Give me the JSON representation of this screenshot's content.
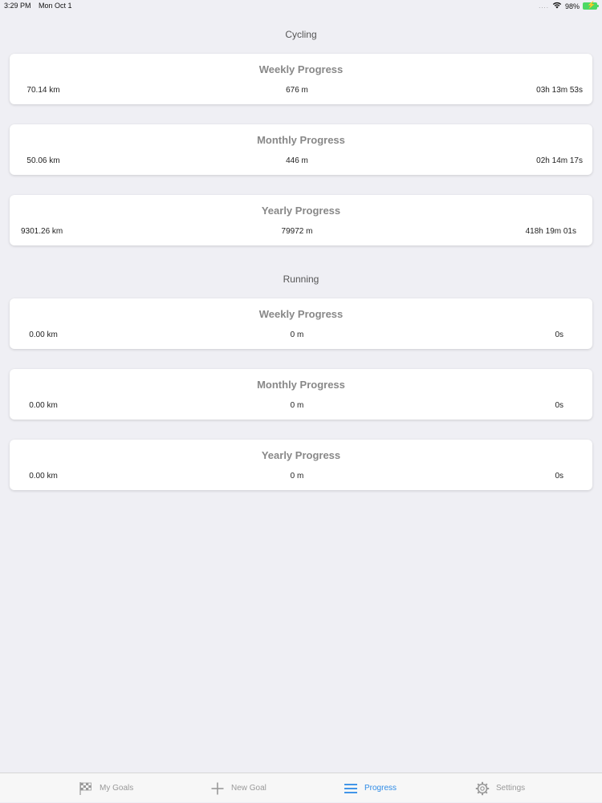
{
  "status_bar": {
    "time": "3:29 PM",
    "date": "Mon Oct 1",
    "signal": "....",
    "battery": "98%"
  },
  "sections": {
    "cycling": {
      "title": "Cycling",
      "weekly": {
        "title": "Weekly Progress",
        "distance": "70.14 km",
        "elevation": "676 m",
        "time": "03h 13m 53s"
      },
      "monthly": {
        "title": "Monthly Progress",
        "distance": "50.06 km",
        "elevation": "446 m",
        "time": "02h 14m 17s"
      },
      "yearly": {
        "title": "Yearly Progress",
        "distance": "9301.26 km",
        "elevation": "79972 m",
        "time": "418h 19m 01s"
      }
    },
    "running": {
      "title": "Running",
      "weekly": {
        "title": "Weekly Progress",
        "distance": "0.00 km",
        "elevation": "0 m",
        "time": "0s"
      },
      "monthly": {
        "title": "Monthly Progress",
        "distance": "0.00 km",
        "elevation": "0 m",
        "time": "0s"
      },
      "yearly": {
        "title": "Yearly Progress",
        "distance": "0.00 km",
        "elevation": "0 m",
        "time": "0s"
      }
    }
  },
  "tab_bar": {
    "items": [
      {
        "label": "My Goals",
        "icon": "checkered-flag-icon"
      },
      {
        "label": "New Goal",
        "icon": "plus-icon"
      },
      {
        "label": "Progress",
        "icon": "list-icon",
        "active": true
      },
      {
        "label": "Settings",
        "icon": "gear-icon"
      }
    ],
    "active_color": "#2e8be6",
    "inactive_color": "#999999"
  }
}
